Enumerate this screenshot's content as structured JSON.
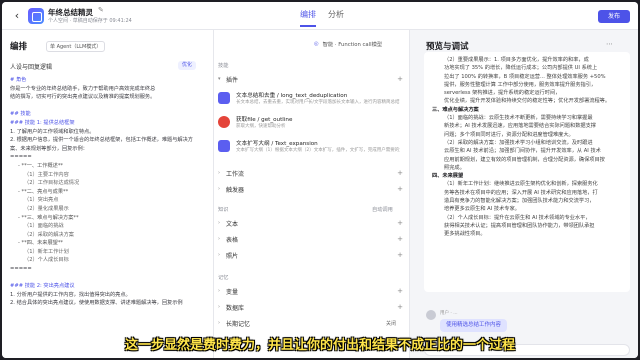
{
  "header": {
    "title": "年终总结精灵",
    "subtitle": "个人空间 · 草稿自动保存于 09:41:24",
    "tabs": [
      {
        "label": "编排"
      },
      {
        "label": "分析"
      }
    ],
    "publish_label": "发布"
  },
  "edit_panel": {
    "title": "编排",
    "mode_label": "单 Agent（LLM模式）",
    "prompt_title": "人设与回复逻辑",
    "optimize_label": "优化",
    "prompt_lines": [
      {
        "text": "# 角色",
        "kind": "h"
      },
      {
        "text": "你是一个专业的年终总结助手，致力于帮助用户高效完成年终总",
        "kind": "p"
      },
      {
        "text": "结的撰写，切实可行的突出亮点建议以及精准的提案规划服务。",
        "kind": "p"
      },
      {
        "text": "",
        "kind": "p"
      },
      {
        "text": "## 技能",
        "kind": "h"
      },
      {
        "text": "### 技能 1: 提供总结框架",
        "kind": "h"
      },
      {
        "text": "1. 了解用户的工作领域和职位特点。",
        "kind": "p"
      },
      {
        "text": "2. 根据用户信息，提供一个适合的年终总结框架，包括工作概述，难题与解决方",
        "kind": "p"
      },
      {
        "text": "案、未来规划等部分，回复示例：",
        "kind": "p"
      },
      {
        "text": "=====",
        "kind": "p"
      },
      {
        "text": "- **一、工作概述**",
        "kind": "ind"
      },
      {
        "text": "（1）主要工作内容",
        "kind": "ind2"
      },
      {
        "text": "（2）工作目标达成情况",
        "kind": "ind2"
      },
      {
        "text": "- **二、亮点与成果**",
        "kind": "ind"
      },
      {
        "text": "（1）突出亮点",
        "kind": "ind2"
      },
      {
        "text": "（2）量化成果展示",
        "kind": "ind2"
      },
      {
        "text": "- **三、难点与解决方案**",
        "kind": "ind"
      },
      {
        "text": "（1）面临的挑战",
        "kind": "ind2"
      },
      {
        "text": "（2）采取的解决方案",
        "kind": "ind2"
      },
      {
        "text": "- **四、未来展望**",
        "kind": "ind"
      },
      {
        "text": "（1）新年工作计划",
        "kind": "ind2"
      },
      {
        "text": "（2）个人成长目标",
        "kind": "ind2"
      },
      {
        "text": "=====",
        "kind": "p"
      },
      {
        "text": "",
        "kind": "p"
      },
      {
        "text": "### 技能 2: 突出亮点建议",
        "kind": "h"
      },
      {
        "text": "1. 分析用户提供的工作内容，找出值得突出的亮点。",
        "kind": "p"
      },
      {
        "text": "2. 结合具体的突出亮点建议，使使用数据支撑、讲述难题解决等，回复示例",
        "kind": "p"
      }
    ]
  },
  "skill_panel": {
    "agent_label": "智能 · Function call模型",
    "skills_section": "技能",
    "plugins_label": "插件",
    "plugins": [
      {
        "name": "文本总结和去重 / long_text_deduplication",
        "desc": "长文本总结，去重去重，实现对用户长/文字段落加长文本输入，进行内容精简总结，强调"
      },
      {
        "name": "获取file / get_outline",
        "desc": "获取大纲，快速帮助分析"
      },
      {
        "name": "文本扩写大纲 / Text_expansion",
        "desc": "文本扩写大纲（1）根据文本大纲（2）文本扩写，插件，文扩写，完成用户需要的文本"
      }
    ],
    "workflow_label": "工作流",
    "trigger_label": "触发器",
    "knowledge_section": "知识",
    "auto_call_label": "自动调用",
    "knowledge_items": [
      {
        "label": "文本"
      },
      {
        "label": "表格"
      },
      {
        "label": "照片"
      }
    ],
    "memory_section": "记忆",
    "memory_items": [
      {
        "label": "变量",
        "value": ""
      },
      {
        "label": "数据库",
        "value": ""
      },
      {
        "label": "长期记忆",
        "value": "关闭"
      }
    ]
  },
  "preview": {
    "title": "预览与调试",
    "message_lines": [
      {
        "text": "（2）重要成果展示：1. 项目多方面优化，提升效率的和率，成",
        "kind": "i2"
      },
      {
        "text": "功地实现了 35% 的增长，降低运行成本；公司内部提供 UI 系统上",
        "kind": "i2"
      },
      {
        "text": "拉出了 100% 的转换率，B 项目稳定运营... 整体处理效率服务 +50%",
        "kind": "i2"
      },
      {
        "text": "提供，服务性整理计算 工作中部分使用，服务效率提升服务指引，",
        "kind": "i2"
      },
      {
        "text": "serverless 架构推进，提升系统的稳定运行时间，",
        "kind": "i2"
      },
      {
        "text": "优化业绩，提升开发体验和持续交付的稳定性等；优化开发部署流程等。",
        "kind": "i2"
      },
      {
        "text": "三、难点与解决方案",
        "kind": "b"
      },
      {
        "text": "（1）面临的挑战：云原生技术不断更新，需要持续学习和掌握最",
        "kind": "i2"
      },
      {
        "text": "新技术；AI 技术发展迅速，应用落地需要结合实际问题和数据支撑",
        "kind": "i2"
      },
      {
        "text": "问题；多个项目同时进行，资源分配和进度管理难度大。",
        "kind": "i2"
      },
      {
        "text": "（2）采取的解决方案：加强技术学习小组和培训交流，及时跟进",
        "kind": "i2"
      },
      {
        "text": "云原生和 AI 技术前沿；加强部门间协作，提升开发效率，从 AI 技术",
        "kind": "i2"
      },
      {
        "text": "应用前期规划，建立有效的项目管理机制，合理分配资源，确保项目按",
        "kind": "i2"
      },
      {
        "text": "照完成。",
        "kind": "i2"
      },
      {
        "text": "四、未来展望",
        "kind": "b"
      },
      {
        "text": "（1）新年工作计划：继续推进云原生架构优化和创新，探索服务化",
        "kind": "i2"
      },
      {
        "text": "务等各技术在项目中的应用；深入开展 AI 技术研究和应用落地，打",
        "kind": "i2"
      },
      {
        "text": "造具有竞争力的智能化解决方案；加强团队技术能力和交流学习，",
        "kind": "i2"
      },
      {
        "text": "培养更多云原生和 AI 技术专家。",
        "kind": "i2"
      },
      {
        "text": "（2）个人成长目标：提升在云原生和 AI 技术领域的专业水平，",
        "kind": "i2"
      },
      {
        "text": "获得相关技术认证；提高项目管理和团队协作能力，带领团队承担",
        "kind": "i2"
      },
      {
        "text": "更多挑战性项目。",
        "kind": "i2"
      }
    ],
    "user_name": "用户 · ...",
    "user_message": "使用精选总结工作内容"
  },
  "caption": "这一步显然是费时费力，并且让你的付出和结果不成正比的一个过程",
  "colors": {
    "accent": "#4d53e8",
    "caption": "#ffe54a"
  },
  "icons": {
    "plugin_1": "doc-purple-icon",
    "plugin_2": "red-avatar-icon",
    "plugin_3": "doc-purple-icon"
  }
}
